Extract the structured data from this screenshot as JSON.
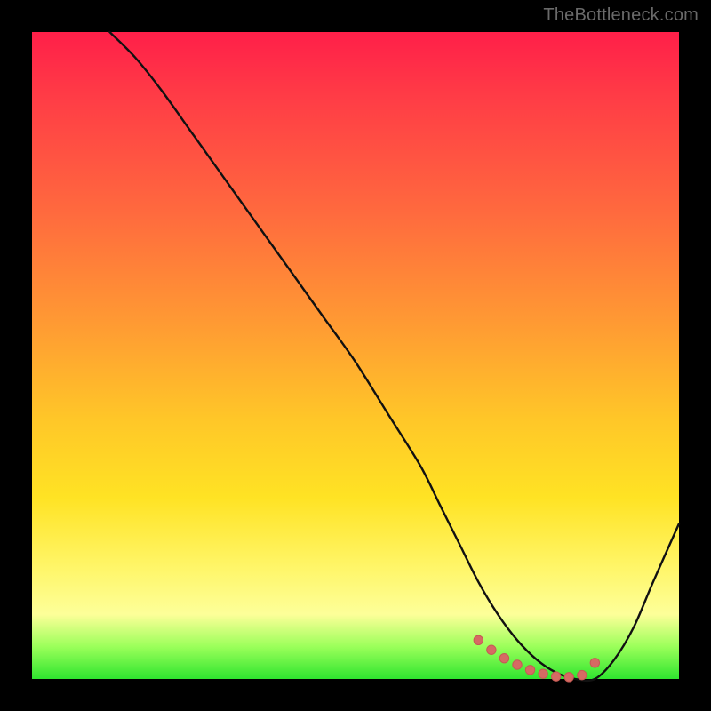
{
  "watermark": "TheBottleneck.com",
  "colors": {
    "frame": "#000000",
    "curve": "#111111",
    "marker_fill": "#d66a63",
    "marker_stroke": "#c55a54",
    "gradient_stops": [
      "#ff1f49",
      "#ff6a3e",
      "#ffc728",
      "#fdff99",
      "#2fe52f"
    ]
  },
  "chart_data": {
    "type": "line",
    "title": "",
    "xlabel": "",
    "ylabel": "",
    "xlim": [
      0,
      100
    ],
    "ylim": [
      0,
      100
    ],
    "grid": false,
    "legend": false,
    "series": [
      {
        "name": "bottleneck-curve",
        "x": [
          12,
          16,
          20,
          25,
          30,
          35,
          40,
          45,
          50,
          55,
          60,
          63,
          66,
          69,
          72,
          75,
          78,
          81,
          84,
          87,
          90,
          93,
          96,
          100
        ],
        "y": [
          100,
          96,
          91,
          84,
          77,
          70,
          63,
          56,
          49,
          41,
          33,
          27,
          21,
          15,
          10,
          6,
          3,
          1,
          0,
          0,
          3,
          8,
          15,
          24
        ]
      }
    ],
    "markers": {
      "name": "trough-highlight",
      "x": [
        69,
        71,
        73,
        75,
        77,
        79,
        81,
        83,
        85,
        87
      ],
      "y": [
        6.0,
        4.5,
        3.2,
        2.2,
        1.4,
        0.8,
        0.4,
        0.3,
        0.6,
        2.5
      ]
    }
  }
}
